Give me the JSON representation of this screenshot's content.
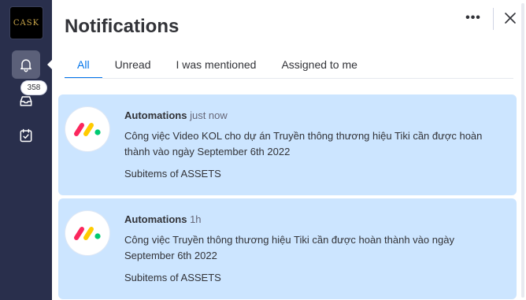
{
  "sidebar": {
    "logo_text": "CASK",
    "badge_count": "358",
    "items": [
      {
        "name": "bell-icon",
        "active": true
      },
      {
        "name": "inbox-icon",
        "active": false
      },
      {
        "name": "calendar-check-icon",
        "active": false
      }
    ]
  },
  "panel": {
    "title": "Notifications",
    "tabs": [
      {
        "label": "All",
        "active": true
      },
      {
        "label": "Unread",
        "active": false
      },
      {
        "label": "I was mentioned",
        "active": false
      },
      {
        "label": "Assigned to me",
        "active": false
      }
    ]
  },
  "notifications": [
    {
      "sender": "Automations",
      "time": "just now",
      "message": "Công việc Video KOL cho dự án Truyền thông thương hiệu Tiki cần được hoàn thành vào ngày September 6th 2022",
      "context": "Subitems of ASSETS"
    },
    {
      "sender": "Automations",
      "time": "1h",
      "message": "Công việc Truyền thông thương hiệu Tiki cần được hoàn thành vào ngày September 6th 2022",
      "context": "Subitems of ASSETS"
    }
  ],
  "colors": {
    "sidebar_bg": "#292f4c",
    "card_bg": "#cce5ff",
    "accent": "#0073ea",
    "logo_red": "#fb275d",
    "logo_yellow": "#ffcb00",
    "logo_green": "#00ca72"
  }
}
